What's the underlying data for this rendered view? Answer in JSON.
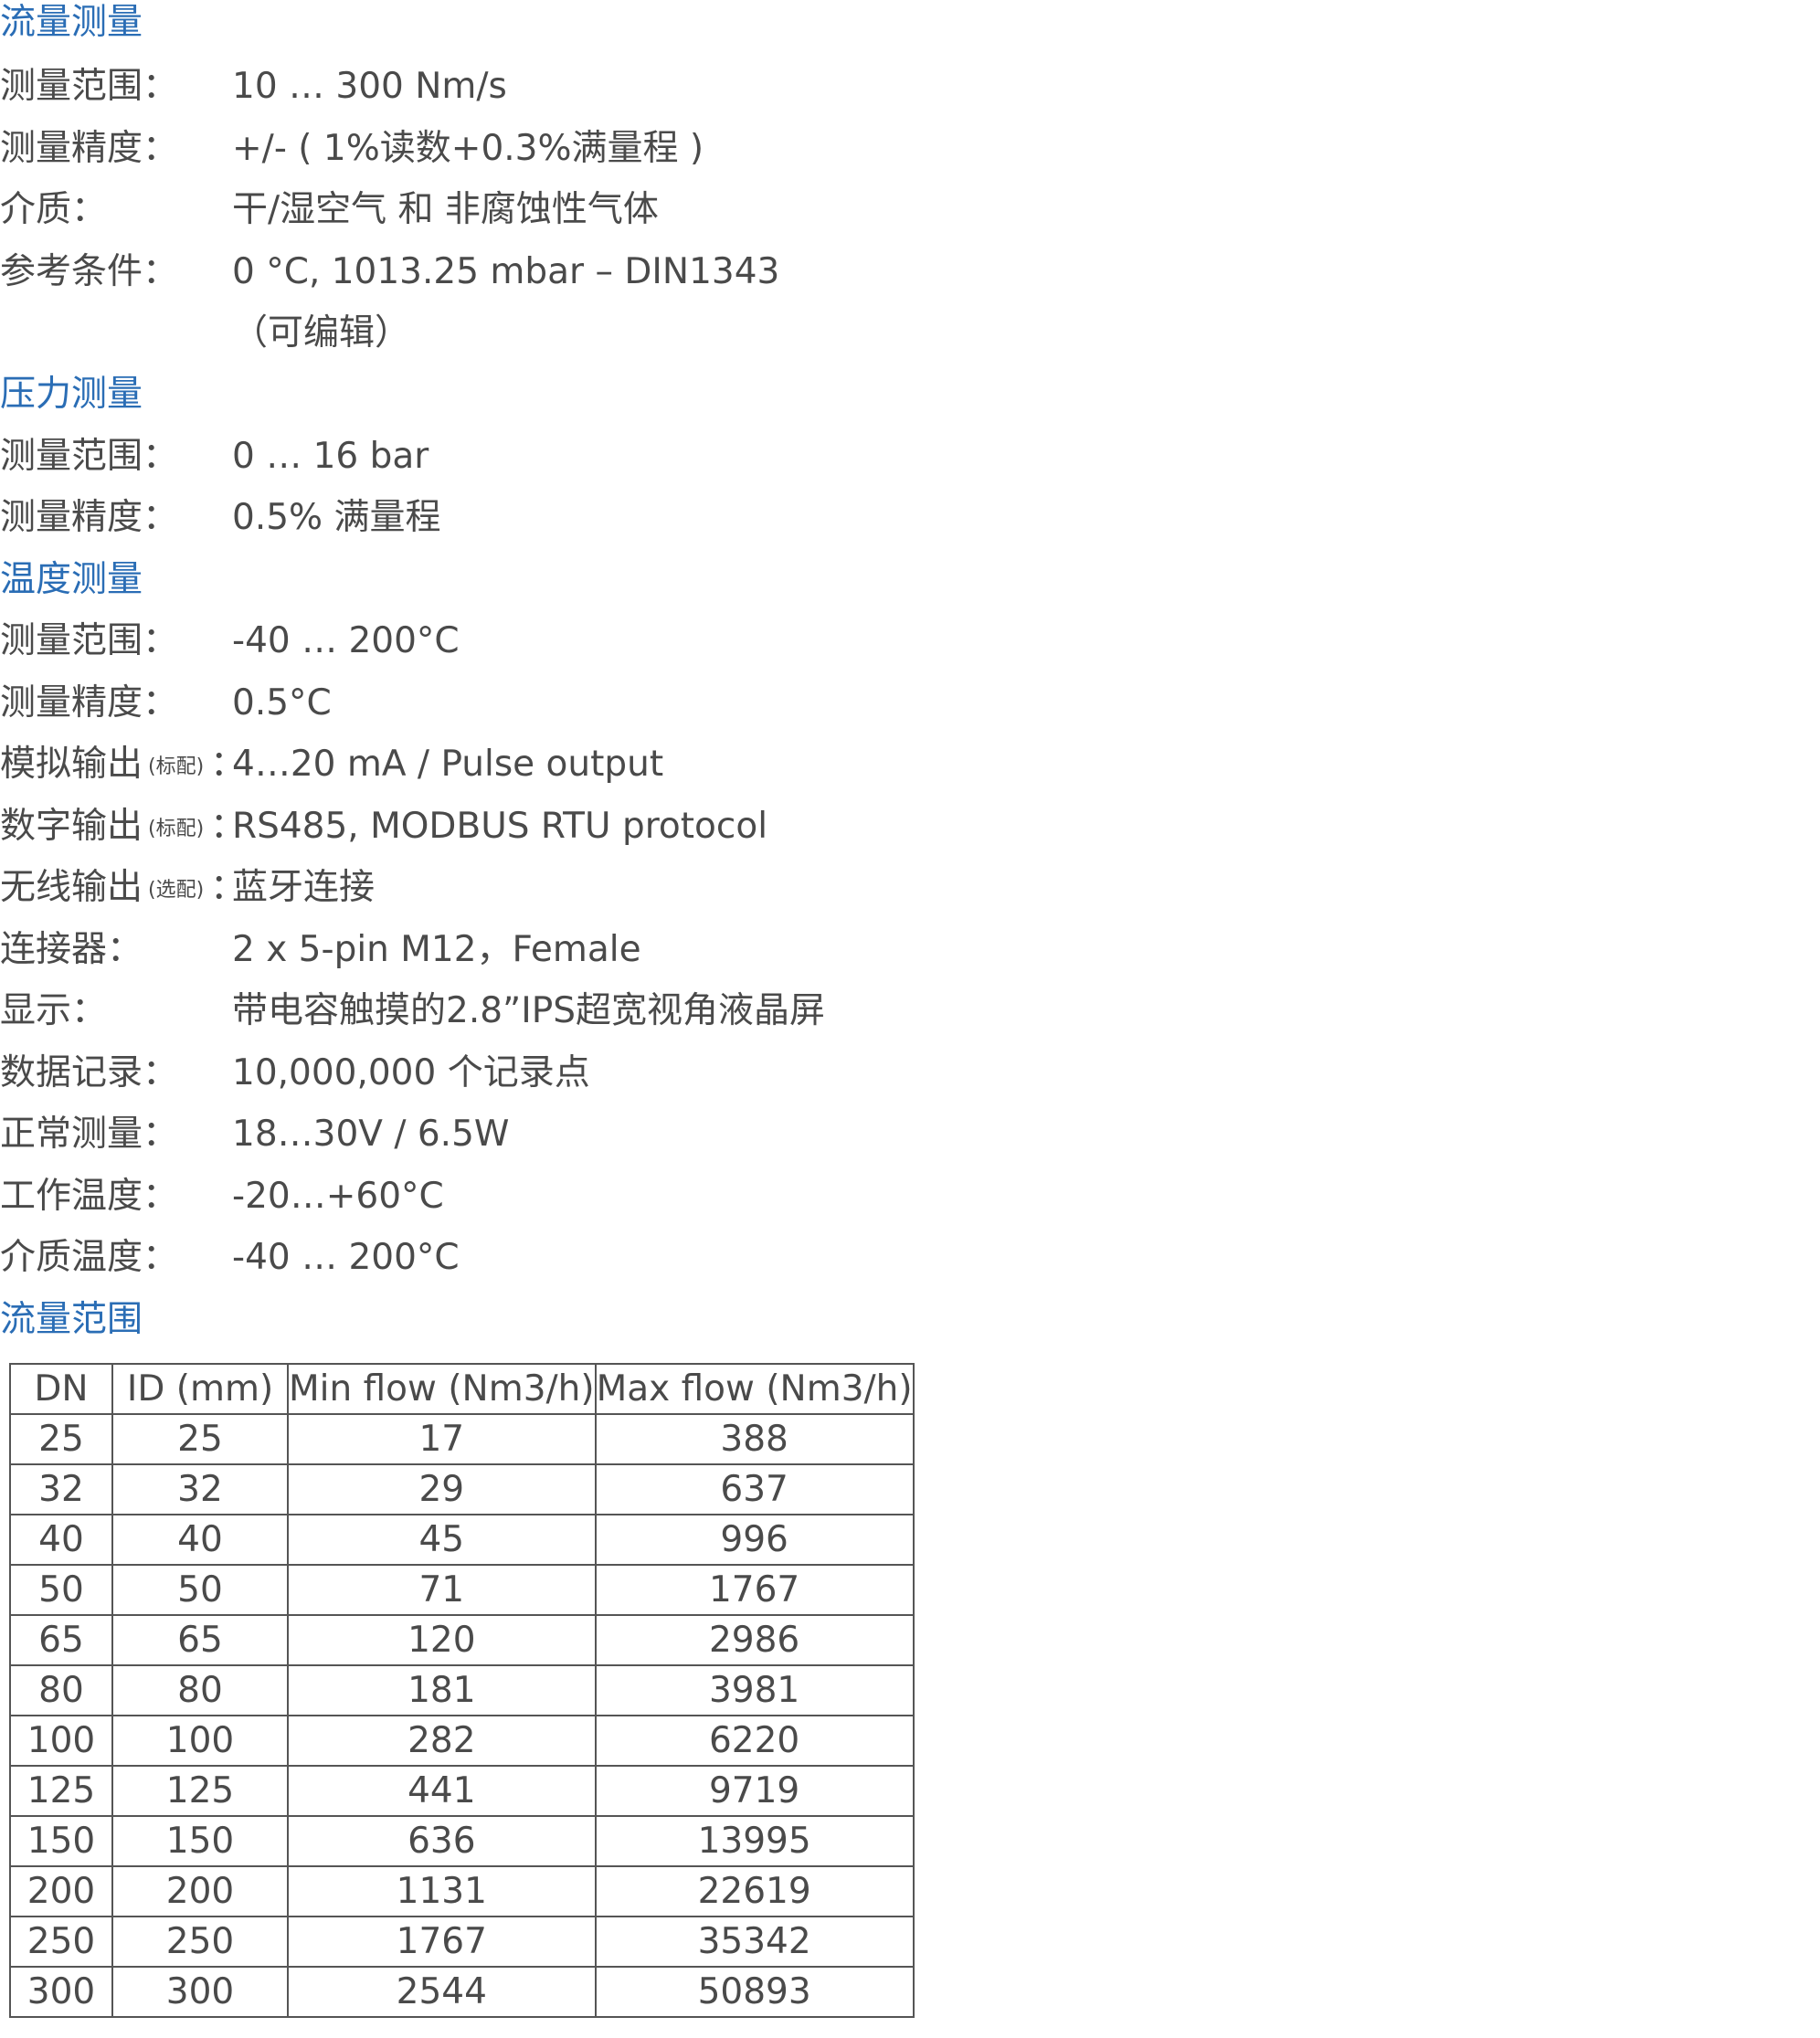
{
  "sections": {
    "flow": {
      "title": "流量测量",
      "range_label": "测量范围：",
      "range_value": "10 … 300 Nm/s",
      "accuracy_label": "测量精度：",
      "accuracy_value": "+/- ( 1%读数+0.3%满量程 )",
      "medium_label": "介质：",
      "medium_value": "干/湿空气 和 非腐蚀性气体",
      "reference_label": "参考条件：",
      "reference_value": "0 °C, 1013.25 mbar – DIN1343",
      "reference_note": "（可编辑）"
    },
    "pressure": {
      "title": "压力测量",
      "range_label": "测量范围：",
      "range_value": "0 … 16 bar",
      "accuracy_label": "测量精度：",
      "accuracy_value": "0.5% 满量程"
    },
    "temperature": {
      "title": "温度测量",
      "range_label": "测量范围：",
      "range_value": "-40 … 200°C",
      "accuracy_label": "测量精度：",
      "accuracy_value": "0.5°C"
    },
    "general": {
      "analog_label": "模拟输出",
      "analog_tag": "(标配)",
      "analog_colon": "：",
      "analog_value": "4…20 mA / Pulse output",
      "digital_label": "数字输出",
      "digital_tag": "(标配)",
      "digital_colon": "：",
      "digital_value": "RS485, MODBUS RTU protocol",
      "wireless_label": "无线输出",
      "wireless_tag": "(选配)",
      "wireless_colon": "：",
      "wireless_value": "蓝牙连接",
      "connector_label": "连接器：",
      "connector_value": "2 x 5-pin M12，Female",
      "display_label": "显示：",
      "display_value": "带电容触摸的2.8”IPS超宽视角液晶屏",
      "logging_label": "数据记录：",
      "logging_value": "10,000,000 个记录点",
      "power_label": "正常测量：",
      "power_value": "18…30V / 6.5W",
      "op_temp_label": "工作温度：",
      "op_temp_value": "-20…+60°C",
      "media_temp_label": "介质温度：",
      "media_temp_value": "-40 … 200°C"
    },
    "flow_range": {
      "title": "流量范围"
    }
  },
  "chart_data": {
    "type": "table",
    "columns": [
      "DN",
      "ID (mm)",
      "Min flow (Nm3/h)",
      "Max flow (Nm3/h)"
    ],
    "rows": [
      [
        "25",
        "25",
        "17",
        "388"
      ],
      [
        "32",
        "32",
        "29",
        "637"
      ],
      [
        "40",
        "40",
        "45",
        "996"
      ],
      [
        "50",
        "50",
        "71",
        "1767"
      ],
      [
        "65",
        "65",
        "120",
        "2986"
      ],
      [
        "80",
        "80",
        "181",
        "3981"
      ],
      [
        "100",
        "100",
        "282",
        "6220"
      ],
      [
        "125",
        "125",
        "441",
        "9719"
      ],
      [
        "150",
        "150",
        "636",
        "13995"
      ],
      [
        "200",
        "200",
        "1131",
        "22619"
      ],
      [
        "250",
        "250",
        "1767",
        "35342"
      ],
      [
        "300",
        "300",
        "2544",
        "50893"
      ]
    ]
  }
}
